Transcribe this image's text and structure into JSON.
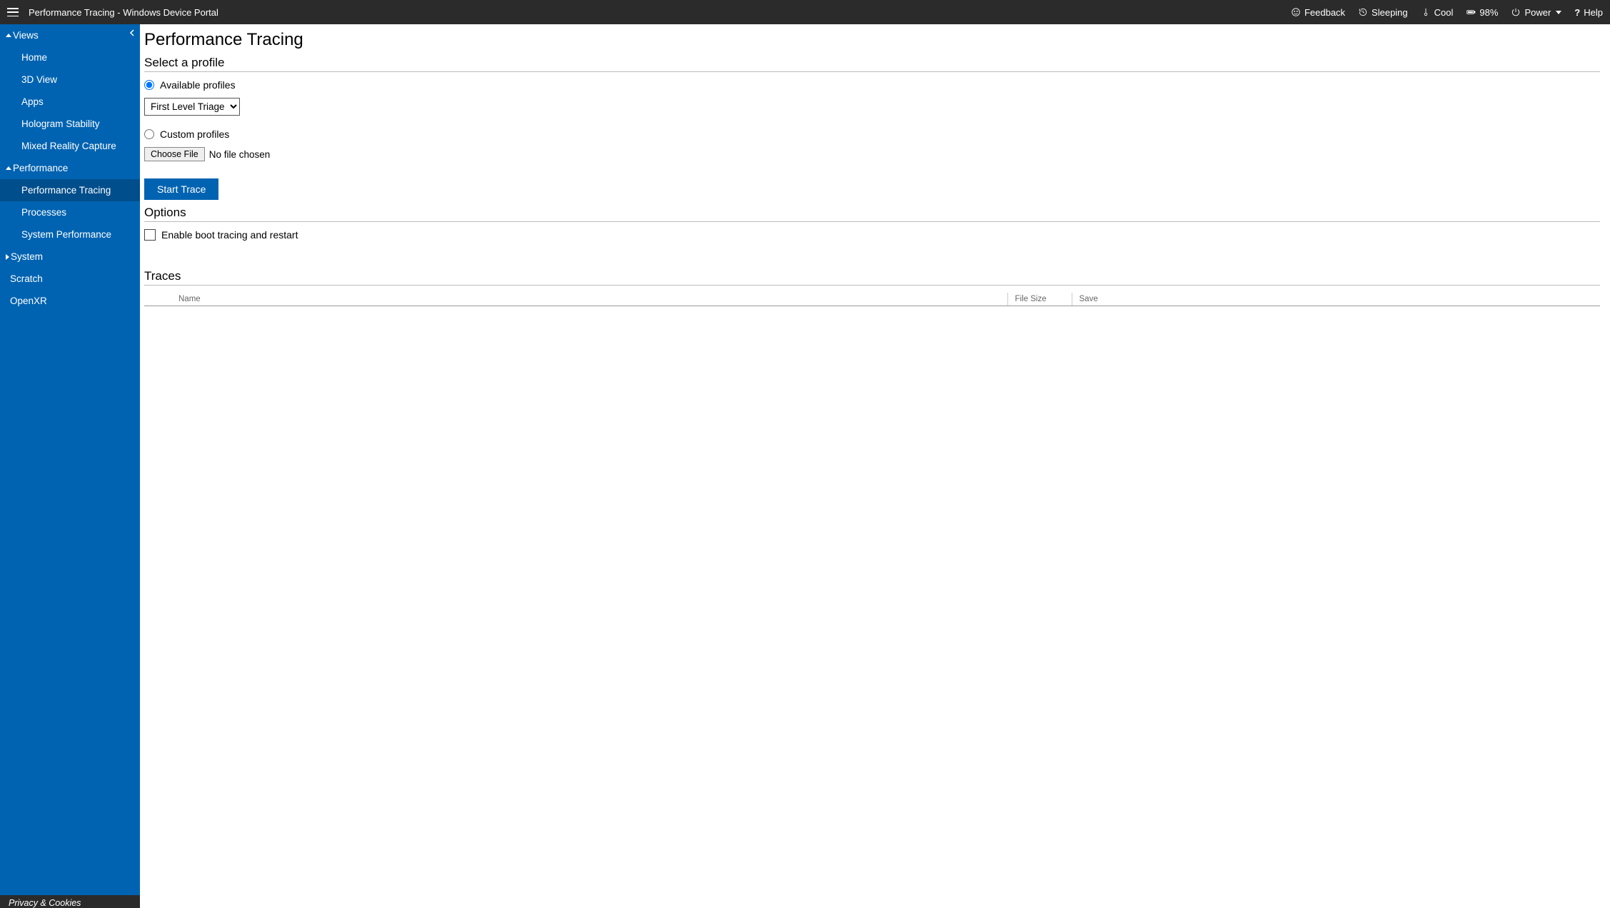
{
  "topbar": {
    "title": "Performance Tracing - Windows Device Portal",
    "feedback": "Feedback",
    "sleeping": "Sleeping",
    "cool": "Cool",
    "battery": "98%",
    "power": "Power",
    "help": "Help"
  },
  "sidebar": {
    "sections": [
      {
        "label": "Views",
        "expanded": true,
        "items": [
          "Home",
          "3D View",
          "Apps",
          "Hologram Stability",
          "Mixed Reality Capture"
        ]
      },
      {
        "label": "Performance",
        "expanded": true,
        "items": [
          "Performance Tracing",
          "Processes",
          "System Performance"
        ],
        "activeIndex": 0
      },
      {
        "label": "System",
        "expanded": false,
        "items": []
      }
    ],
    "toplevel": [
      "Scratch",
      "OpenXR"
    ],
    "footer": "Privacy & Cookies"
  },
  "main": {
    "title": "Performance Tracing",
    "section_profile": "Select a profile",
    "radio_available": "Available profiles",
    "profile_selected": "First Level Triage",
    "radio_custom": "Custom profiles",
    "choose_file_btn": "Choose File",
    "no_file": "No file chosen",
    "start_trace": "Start Trace",
    "section_options": "Options",
    "enable_boot": "Enable boot tracing and restart",
    "section_traces": "Traces",
    "table": {
      "col_name": "Name",
      "col_filesize": "File Size",
      "col_save": "Save"
    }
  }
}
